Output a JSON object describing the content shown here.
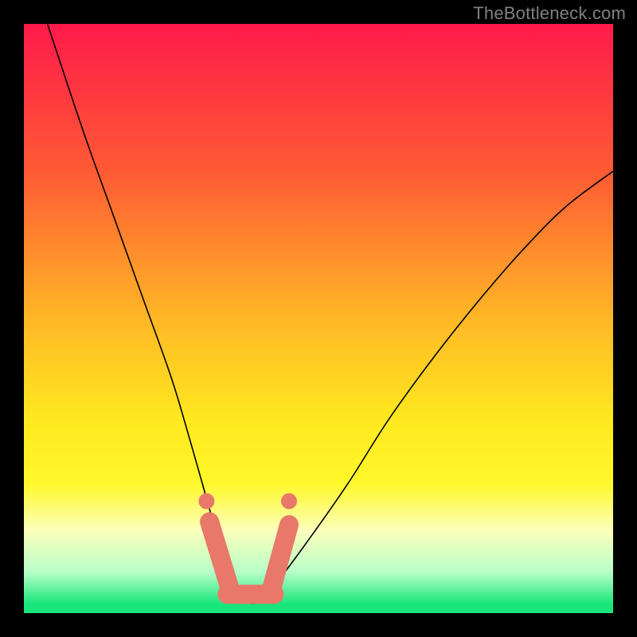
{
  "watermark": "TheBottleneck.com",
  "chart_data": {
    "type": "line",
    "title": "",
    "xlabel": "",
    "ylabel": "",
    "xlim": [
      0,
      100
    ],
    "ylim": [
      0,
      100
    ],
    "grid": false,
    "legend": false,
    "background": {
      "type": "vertical-gradient",
      "stops": [
        {
          "pos": 0.0,
          "color": "#ff1a4b"
        },
        {
          "pos": 0.25,
          "color": "#ff5a34"
        },
        {
          "pos": 0.5,
          "color": "#ffb726"
        },
        {
          "pos": 0.67,
          "color": "#ffe81f"
        },
        {
          "pos": 0.78,
          "color": "#fff82a"
        },
        {
          "pos": 0.86,
          "color": "#fcffbb"
        },
        {
          "pos": 0.93,
          "color": "#b8ffc9"
        },
        {
          "pos": 0.985,
          "color": "#18e57a"
        },
        {
          "pos": 1.0,
          "color": "#18e57a"
        }
      ]
    },
    "series": [
      {
        "name": "bottleneck-curve",
        "color": "#000000",
        "stroke_width": 1.6,
        "x": [
          4,
          10,
          15,
          20,
          25,
          28,
          30,
          32,
          34,
          36,
          38,
          40,
          42,
          48,
          55,
          62,
          70,
          78,
          85,
          92,
          100
        ],
        "values": [
          100,
          82,
          68,
          54,
          40,
          30,
          23,
          16,
          10,
          5,
          2,
          2,
          4,
          12,
          22,
          33,
          44,
          54,
          62,
          69,
          75
        ]
      }
    ],
    "markers": [
      {
        "name": "dot-left",
        "shape": "circle",
        "color": "#e9776a",
        "size": 10,
        "x": 31,
        "y": 19
      },
      {
        "name": "dot-right",
        "shape": "circle",
        "color": "#e9776a",
        "size": 10,
        "x": 45,
        "y": 19
      },
      {
        "name": "capsule-left",
        "shape": "capsule",
        "color": "#e9776a",
        "width": 24,
        "x1": 31.5,
        "y1": 15.5,
        "x2": 35.0,
        "y2": 4.0
      },
      {
        "name": "capsule-bottom",
        "shape": "capsule",
        "color": "#e9776a",
        "width": 24,
        "x1": 34.5,
        "y1": 3.2,
        "x2": 42.5,
        "y2": 3.2
      },
      {
        "name": "capsule-right",
        "shape": "capsule",
        "color": "#e9776a",
        "width": 24,
        "x1": 42.0,
        "y1": 4.0,
        "x2": 45.0,
        "y2": 15.0
      }
    ]
  }
}
